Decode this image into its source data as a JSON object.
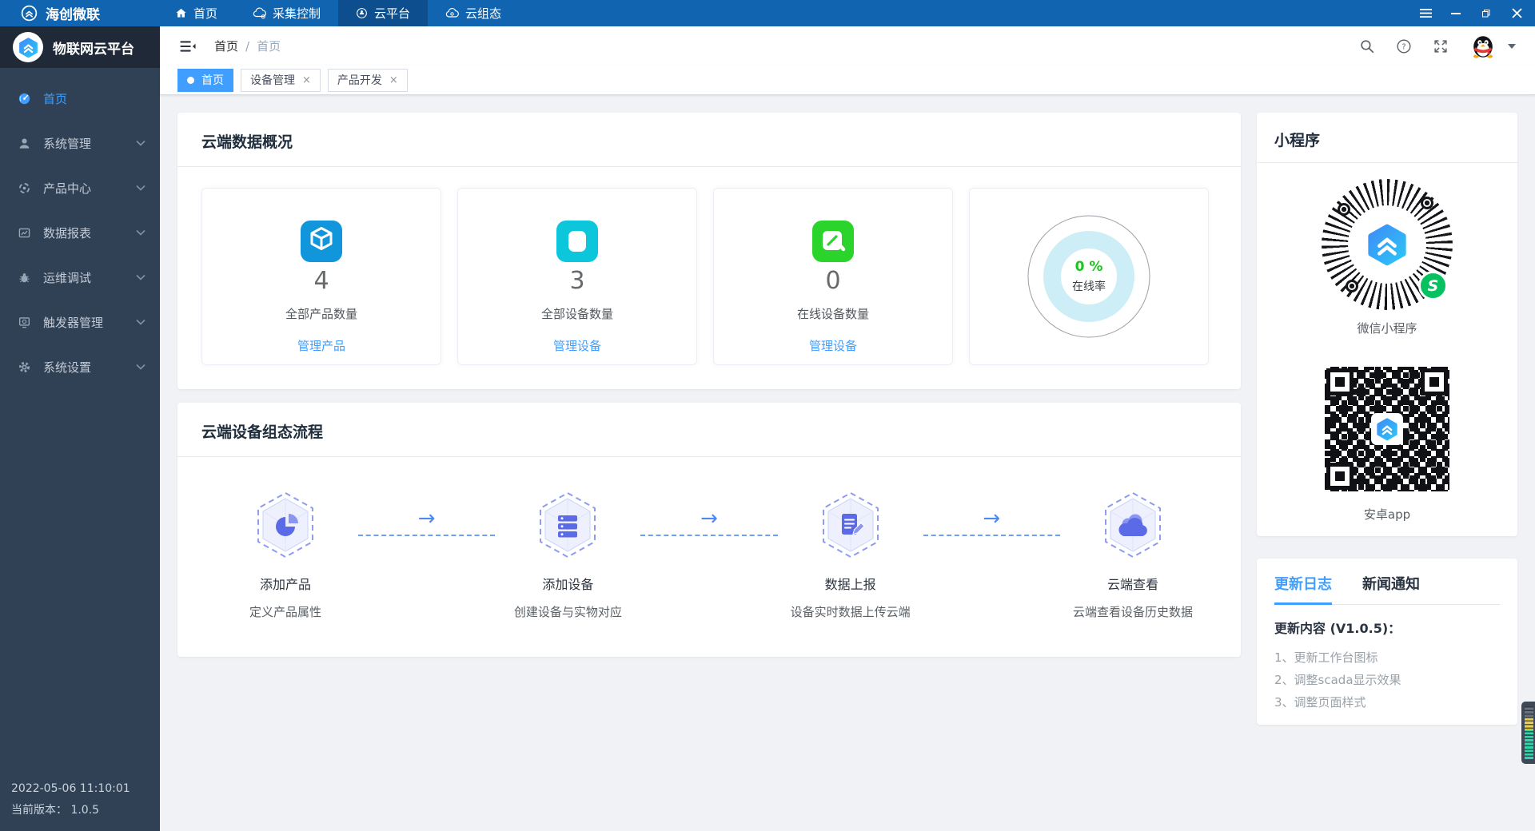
{
  "topbar": {
    "brand": "海创微联",
    "nav": [
      {
        "label": "首页"
      },
      {
        "label": "采集控制"
      },
      {
        "label": "云平台"
      },
      {
        "label": "云组态"
      }
    ]
  },
  "sidebar": {
    "title": "物联网云平台",
    "menu": [
      {
        "label": "首页"
      },
      {
        "label": "系统管理"
      },
      {
        "label": "产品中心"
      },
      {
        "label": "数据报表"
      },
      {
        "label": "运维调试"
      },
      {
        "label": "触发器管理"
      },
      {
        "label": "系统设置"
      }
    ],
    "footer_datetime": "2022-05-06 11:10:01",
    "footer_version": "当前版本： 1.0.5"
  },
  "header": {
    "breadcrumb": [
      "首页",
      "首页"
    ],
    "separator": "/"
  },
  "tabs": [
    {
      "label": "首页"
    },
    {
      "label": "设备管理"
    },
    {
      "label": "产品开发"
    }
  ],
  "overview": {
    "title": "云端数据概况",
    "cards": [
      {
        "value": "4",
        "label": "全部产品数量",
        "link": "管理产品"
      },
      {
        "value": "3",
        "label": "全部设备数量",
        "link": "管理设备"
      },
      {
        "value": "0",
        "label": "在线设备数量",
        "link": "管理设备"
      }
    ],
    "donut": {
      "percent": "0 %",
      "label": "在线率",
      "value_percent": 0
    }
  },
  "flow": {
    "title": "云端设备组态流程",
    "steps": [
      {
        "title": "添加产品",
        "desc": "定义产品属性"
      },
      {
        "title": "添加设备",
        "desc": "创建设备与实物对应"
      },
      {
        "title": "数据上报",
        "desc": "设备实时数据上传云端"
      },
      {
        "title": "云端查看",
        "desc": "云端查看设备历史数据"
      }
    ]
  },
  "miniapp": {
    "title": "小程序",
    "wechat_label": "微信小程序",
    "android_label": "安卓app"
  },
  "updates": {
    "tab_log": "更新日志",
    "tab_news": "新闻通知",
    "heading": "更新内容 (V1.0.5)：",
    "items": [
      "1、更新工作台图标",
      "2、调整scada显示效果",
      "3、调整页面样式"
    ]
  },
  "colors": {
    "accent": "#409eff",
    "topbar_blue": "#1165b0",
    "green_percent": "#1dc41d",
    "card_icon_blue": "#1296db",
    "card_icon_cyan": "#0cc6db",
    "card_icon_green": "#2bd42b"
  }
}
